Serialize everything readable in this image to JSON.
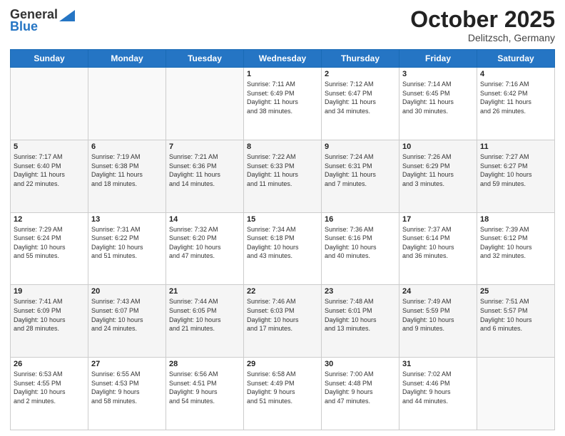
{
  "header": {
    "logo_line1": "General",
    "logo_line2": "Blue",
    "month_title": "October 2025",
    "location": "Delitzsch, Germany"
  },
  "weekdays": [
    "Sunday",
    "Monday",
    "Tuesday",
    "Wednesday",
    "Thursday",
    "Friday",
    "Saturday"
  ],
  "weeks": [
    [
      {
        "day": "",
        "info": ""
      },
      {
        "day": "",
        "info": ""
      },
      {
        "day": "",
        "info": ""
      },
      {
        "day": "1",
        "info": "Sunrise: 7:11 AM\nSunset: 6:49 PM\nDaylight: 11 hours\nand 38 minutes."
      },
      {
        "day": "2",
        "info": "Sunrise: 7:12 AM\nSunset: 6:47 PM\nDaylight: 11 hours\nand 34 minutes."
      },
      {
        "day": "3",
        "info": "Sunrise: 7:14 AM\nSunset: 6:45 PM\nDaylight: 11 hours\nand 30 minutes."
      },
      {
        "day": "4",
        "info": "Sunrise: 7:16 AM\nSunset: 6:42 PM\nDaylight: 11 hours\nand 26 minutes."
      }
    ],
    [
      {
        "day": "5",
        "info": "Sunrise: 7:17 AM\nSunset: 6:40 PM\nDaylight: 11 hours\nand 22 minutes."
      },
      {
        "day": "6",
        "info": "Sunrise: 7:19 AM\nSunset: 6:38 PM\nDaylight: 11 hours\nand 18 minutes."
      },
      {
        "day": "7",
        "info": "Sunrise: 7:21 AM\nSunset: 6:36 PM\nDaylight: 11 hours\nand 14 minutes."
      },
      {
        "day": "8",
        "info": "Sunrise: 7:22 AM\nSunset: 6:33 PM\nDaylight: 11 hours\nand 11 minutes."
      },
      {
        "day": "9",
        "info": "Sunrise: 7:24 AM\nSunset: 6:31 PM\nDaylight: 11 hours\nand 7 minutes."
      },
      {
        "day": "10",
        "info": "Sunrise: 7:26 AM\nSunset: 6:29 PM\nDaylight: 11 hours\nand 3 minutes."
      },
      {
        "day": "11",
        "info": "Sunrise: 7:27 AM\nSunset: 6:27 PM\nDaylight: 10 hours\nand 59 minutes."
      }
    ],
    [
      {
        "day": "12",
        "info": "Sunrise: 7:29 AM\nSunset: 6:24 PM\nDaylight: 10 hours\nand 55 minutes."
      },
      {
        "day": "13",
        "info": "Sunrise: 7:31 AM\nSunset: 6:22 PM\nDaylight: 10 hours\nand 51 minutes."
      },
      {
        "day": "14",
        "info": "Sunrise: 7:32 AM\nSunset: 6:20 PM\nDaylight: 10 hours\nand 47 minutes."
      },
      {
        "day": "15",
        "info": "Sunrise: 7:34 AM\nSunset: 6:18 PM\nDaylight: 10 hours\nand 43 minutes."
      },
      {
        "day": "16",
        "info": "Sunrise: 7:36 AM\nSunset: 6:16 PM\nDaylight: 10 hours\nand 40 minutes."
      },
      {
        "day": "17",
        "info": "Sunrise: 7:37 AM\nSunset: 6:14 PM\nDaylight: 10 hours\nand 36 minutes."
      },
      {
        "day": "18",
        "info": "Sunrise: 7:39 AM\nSunset: 6:12 PM\nDaylight: 10 hours\nand 32 minutes."
      }
    ],
    [
      {
        "day": "19",
        "info": "Sunrise: 7:41 AM\nSunset: 6:09 PM\nDaylight: 10 hours\nand 28 minutes."
      },
      {
        "day": "20",
        "info": "Sunrise: 7:43 AM\nSunset: 6:07 PM\nDaylight: 10 hours\nand 24 minutes."
      },
      {
        "day": "21",
        "info": "Sunrise: 7:44 AM\nSunset: 6:05 PM\nDaylight: 10 hours\nand 21 minutes."
      },
      {
        "day": "22",
        "info": "Sunrise: 7:46 AM\nSunset: 6:03 PM\nDaylight: 10 hours\nand 17 minutes."
      },
      {
        "day": "23",
        "info": "Sunrise: 7:48 AM\nSunset: 6:01 PM\nDaylight: 10 hours\nand 13 minutes."
      },
      {
        "day": "24",
        "info": "Sunrise: 7:49 AM\nSunset: 5:59 PM\nDaylight: 10 hours\nand 9 minutes."
      },
      {
        "day": "25",
        "info": "Sunrise: 7:51 AM\nSunset: 5:57 PM\nDaylight: 10 hours\nand 6 minutes."
      }
    ],
    [
      {
        "day": "26",
        "info": "Sunrise: 6:53 AM\nSunset: 4:55 PM\nDaylight: 10 hours\nand 2 minutes."
      },
      {
        "day": "27",
        "info": "Sunrise: 6:55 AM\nSunset: 4:53 PM\nDaylight: 9 hours\nand 58 minutes."
      },
      {
        "day": "28",
        "info": "Sunrise: 6:56 AM\nSunset: 4:51 PM\nDaylight: 9 hours\nand 54 minutes."
      },
      {
        "day": "29",
        "info": "Sunrise: 6:58 AM\nSunset: 4:49 PM\nDaylight: 9 hours\nand 51 minutes."
      },
      {
        "day": "30",
        "info": "Sunrise: 7:00 AM\nSunset: 4:48 PM\nDaylight: 9 hours\nand 47 minutes."
      },
      {
        "day": "31",
        "info": "Sunrise: 7:02 AM\nSunset: 4:46 PM\nDaylight: 9 hours\nand 44 minutes."
      },
      {
        "day": "",
        "info": ""
      }
    ]
  ]
}
